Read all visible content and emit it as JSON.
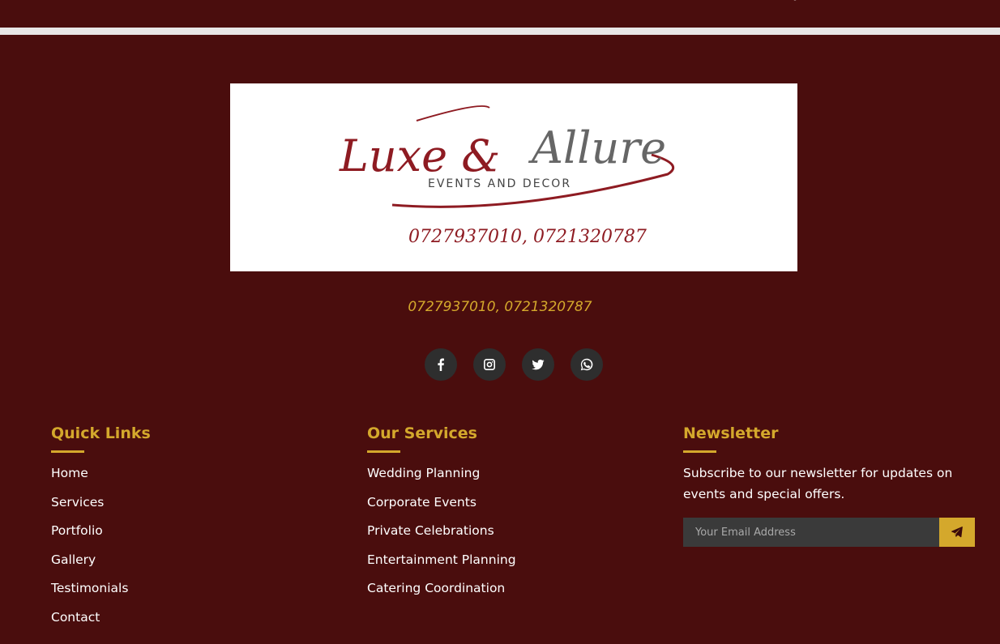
{
  "colors": {
    "background": "#4a0d0d",
    "accent": "#d4a82c",
    "text": "#ffffff",
    "social_bg": "#2e2e2e",
    "input_bg": "#3a3a3a",
    "logo_red": "#8e1b22",
    "logo_gray": "#666666"
  },
  "logo": {
    "script_left": "Luxe &",
    "script_right": "Allure",
    "tagline": "EVENTS AND DECOR",
    "phones": "0727937010, 0721320787"
  },
  "contact": {
    "phones": "0727937010, 0721320787"
  },
  "socials": [
    {
      "name": "facebook",
      "icon": "facebook-icon"
    },
    {
      "name": "instagram",
      "icon": "instagram-icon"
    },
    {
      "name": "twitter",
      "icon": "twitter-icon"
    },
    {
      "name": "whatsapp",
      "icon": "whatsapp-icon"
    }
  ],
  "quick_links": {
    "title": "Quick Links",
    "items": [
      "Home",
      "Services",
      "Portfolio",
      "Gallery",
      "Testimonials",
      "Contact"
    ]
  },
  "services": {
    "title": "Our Services",
    "items": [
      "Wedding Planning",
      "Corporate Events",
      "Private Celebrations",
      "Entertainment Planning",
      "Catering Coordination"
    ]
  },
  "newsletter": {
    "title": "Newsletter",
    "description": "Subscribe to our newsletter for updates on events and special offers.",
    "placeholder": "Your Email Address",
    "submit_icon": "paper-plane-icon"
  }
}
